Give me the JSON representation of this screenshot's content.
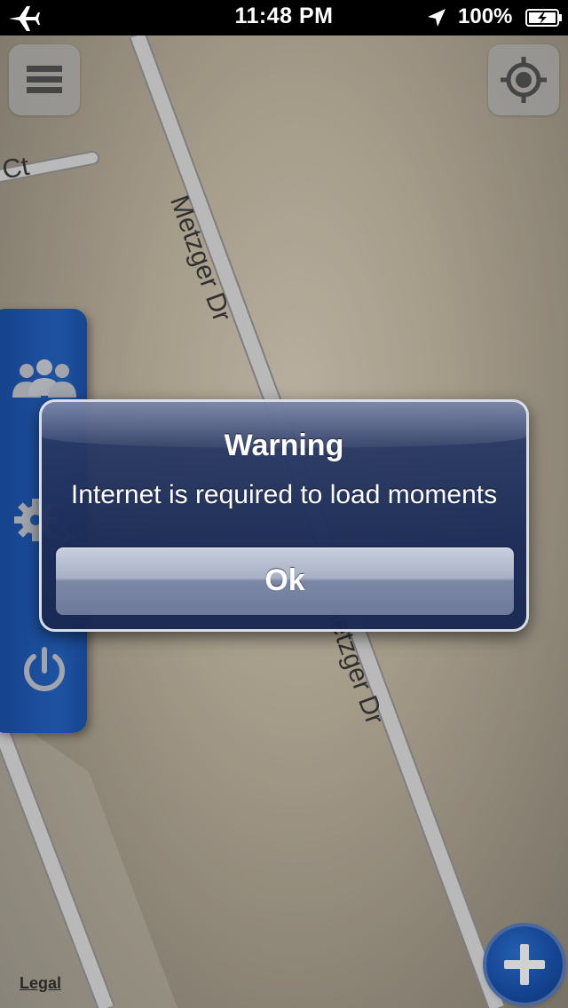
{
  "status_bar": {
    "time": "11:48 PM",
    "battery_percent": "100%",
    "icons": [
      "airplane-icon",
      "location-arrow-icon",
      "battery-charging-icon"
    ]
  },
  "map": {
    "streets": [
      {
        "label": "Metzger Dr"
      },
      {
        "label": "Metzger Dr"
      },
      {
        "label": "Ct"
      }
    ],
    "legal_label": "Legal"
  },
  "toolbar": {
    "menu_icon": "hamburger-menu-icon",
    "locate_icon": "crosshair-locate-icon",
    "add_icon": "plus-icon"
  },
  "side_panel": {
    "items": [
      {
        "icon": "people-group-icon"
      },
      {
        "icon": "gears-settings-icon"
      },
      {
        "icon": "power-icon"
      }
    ]
  },
  "alert": {
    "title": "Warning",
    "message": "Internet is required to load moments",
    "button_label": "Ok"
  },
  "colors": {
    "side_panel": "#2566c6",
    "alert_bg": "#1c2c58",
    "add_button": "#1a55b3"
  }
}
